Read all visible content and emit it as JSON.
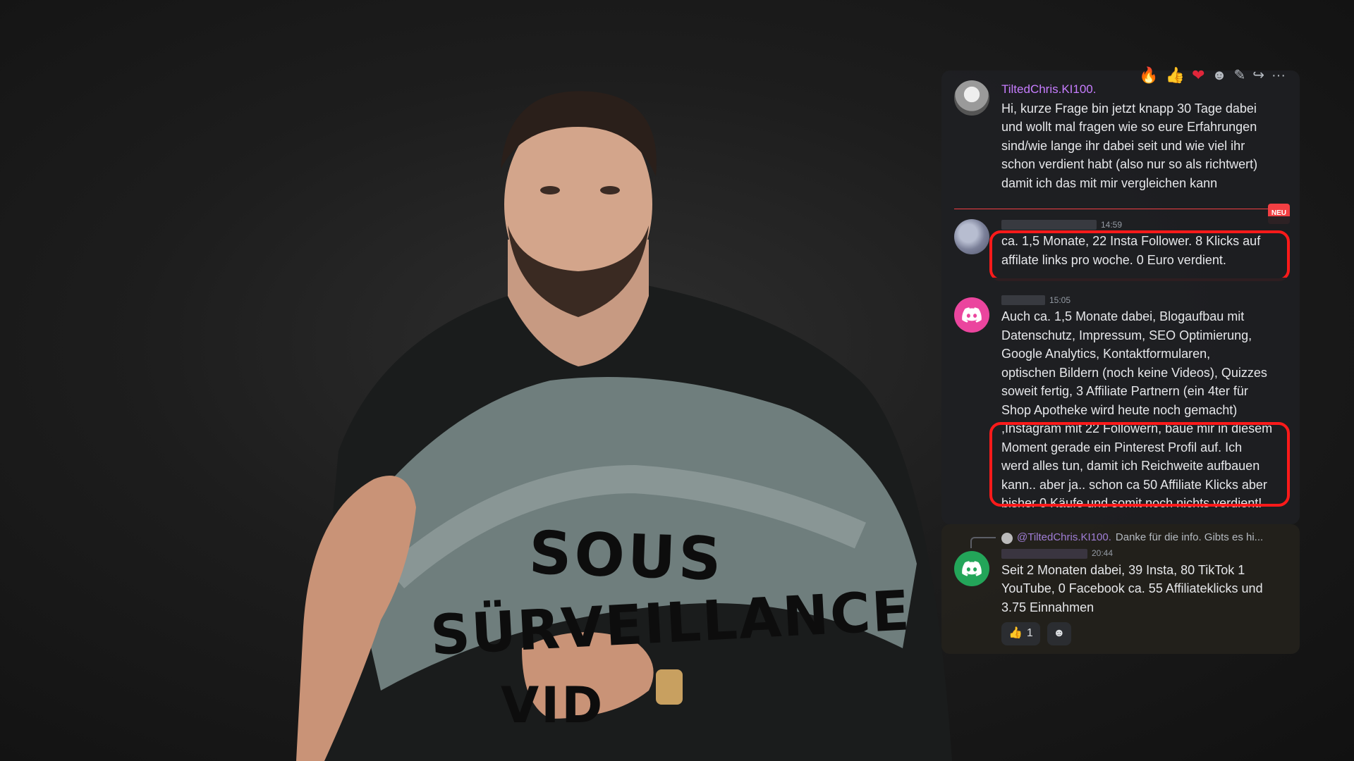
{
  "shirt": {
    "line1": "SOUS",
    "line2": "SÜRVEILLANCE",
    "line3": "VID"
  },
  "toolbar": {
    "fire": "🔥",
    "thumbs": "👍",
    "heart": "❤",
    "emoji_add": "☻",
    "edit": "✎",
    "forward": "↪",
    "more": "···"
  },
  "messages": [
    {
      "username": "TiltedChris.KI100.",
      "lines": [
        "Hi, kurze Frage bin jetzt knapp 30 Tage dabei",
        "und wollt mal fragen wie so eure Erfahrungen",
        "sind/wie lange ihr dabei seit und wie viel ihr",
        "schon verdient habt (also nur so als richtwert)",
        "damit ich das mit mir vergleichen kann"
      ]
    },
    {
      "timestamp": "14:59",
      "lines": [
        "ca. 1,5 Monate, 22 Insta Follower. 8 Klicks auf",
        "affilate links pro woche. 0 Euro verdient."
      ]
    },
    {
      "timestamp": "15:05",
      "lines": [
        "Auch ca. 1,5 Monate dabei, Blogaufbau mit",
        "Datenschutz, Impressum, SEO Optimierung,",
        "Google Analytics,  Kontaktformularen,",
        "optischen Bildern (noch keine Videos), Quizzes",
        "soweit fertig,  3 Affiliate Partnern (ein 4ter für",
        "Shop Apotheke wird heute noch gemacht)",
        ",Instagram mit 22 Followern, baue mir in diesem",
        "Moment gerade ein Pinterest Profil auf. Ich",
        "werd alles tun, damit ich Reichweite aufbauen",
        "kann.. aber ja.. schon ca 50 Affiliate Klicks aber",
        "bisher 0 Käufe und somit noch nichts verdient!"
      ]
    },
    {
      "reply_mention": "@TiltedChris.KI100.",
      "reply_text": "Danke für die info. Gibts es hi...",
      "timestamp": "20:44",
      "lines": [
        "Seit 2 Monaten dabei, 39 Insta, 80 TikTok 1",
        "YouTube, 0 Facebook ca. 55 Affiliateklicks und",
        "3.75 Einnahmen"
      ],
      "reaction_emoji": "👍",
      "reaction_count": "1",
      "reaction_add": "☻"
    }
  ],
  "new_badge": "NEU",
  "colors": {
    "highlight": "#ff1a1a",
    "discord_pink": "#eb459e",
    "discord_green": "#23a559",
    "username": "#c77dff"
  }
}
